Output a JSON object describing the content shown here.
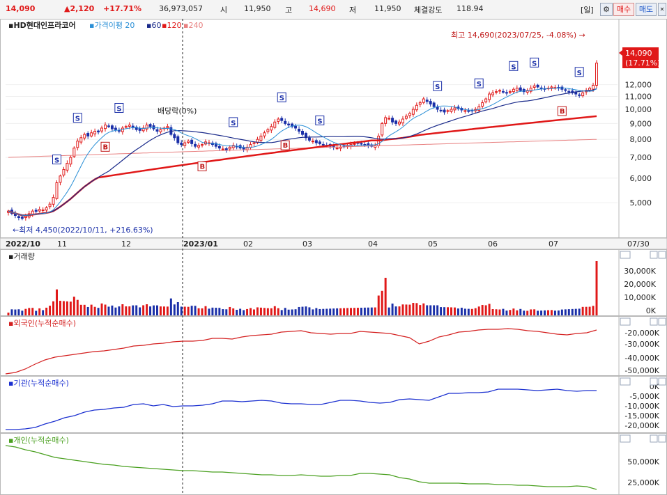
{
  "header": {
    "price": "14,090",
    "change": "▲2,120",
    "change_pct": "+17.71%",
    "volume": "36,973,057",
    "open_label": "시",
    "open": "11,950",
    "high_label": "고",
    "high": "14,690",
    "low_label": "저",
    "low": "11,950",
    "strength_label": "체결강도",
    "strength": "118.94",
    "period": "[일]",
    "sell_button": "매수",
    "buy_button": "매도"
  },
  "price_panel": {
    "name": "HD현대인프라코어",
    "legend_ma_label": "가격이평",
    "legend_ma": [
      "20",
      "60",
      "120",
      "240"
    ],
    "high_note": "최고 14,690(2023/07/25, -4.08%)",
    "low_note": "최저 4,450(2022/10/11, +216.63%)",
    "dividend_note": "배당락(0%)",
    "last_price": "14,090",
    "last_pct": "(17.71%)"
  },
  "volume_panel": {
    "title": "거래량"
  },
  "foreign_panel": {
    "title": "외국인(누적순매수)"
  },
  "inst_panel": {
    "title": "기관(누적순매수)"
  },
  "indiv_panel": {
    "title": "개인(누적순매수)"
  },
  "x_axis": {
    "labels": [
      "2022/10",
      "11",
      "12",
      "2023/01",
      "02",
      "03",
      "04",
      "05",
      "06",
      "07",
      "07/30"
    ]
  },
  "colors": {
    "up": "#e01818",
    "down": "#1a2fa8",
    "ma20": "#2a8fd6",
    "ma60": "#1a2a8a",
    "ma120": "#e01818",
    "ma240": "#e88080",
    "foreign": "#d42020",
    "inst": "#1a2fd0",
    "indiv": "#4aa020"
  },
  "chart_data": {
    "type": "candlestick",
    "log_scale": true,
    "y_ticks": [
      5000,
      6000,
      7000,
      8000,
      9000,
      10000,
      11000,
      12000
    ],
    "ylim": [
      4200,
      16500
    ],
    "closes": [
      4700,
      4620,
      4550,
      4480,
      4450,
      4520,
      4610,
      4700,
      4690,
      4760,
      4740,
      4820,
      4950,
      5200,
      5800,
      6100,
      6400,
      6700,
      7000,
      7500,
      7900,
      8100,
      8300,
      8200,
      8400,
      8500,
      8450,
      8700,
      8900,
      8800,
      8650,
      8600,
      8500,
      8700,
      8800,
      8900,
      8750,
      8600,
      8550,
      8700,
      8900,
      8800,
      8650,
      8500,
      8600,
      8700,
      8800,
      8300,
      8100,
      7800,
      7700,
      7800,
      7900,
      7750,
      7600,
      7650,
      7700,
      7850,
      7800,
      7700,
      7600,
      7500,
      7450,
      7400,
      7550,
      7650,
      7600,
      7500,
      7450,
      7550,
      7700,
      7800,
      8000,
      8200,
      8400,
      8600,
      8800,
      9100,
      9300,
      9200,
      9000,
      8900,
      8800,
      8700,
      8500,
      8300,
      8100,
      7950,
      7900,
      7800,
      7750,
      7700,
      7650,
      7600,
      7550,
      7500,
      7550,
      7600,
      7650,
      7700,
      7750,
      7800,
      7750,
      7700,
      7650,
      7600,
      7650,
      8200,
      9000,
      9400,
      9350,
      9100,
      9000,
      9100,
      9300,
      9500,
      9700,
      10000,
      10300,
      10500,
      10800,
      10600,
      10400,
      10200,
      10000,
      9900,
      9800,
      9900,
      10000,
      10100,
      10050,
      9950,
      9900,
      9850,
      9900,
      10000,
      10200,
      10500,
      10800,
      11200,
      11300,
      11400,
      11500,
      11350,
      11300,
      11400,
      11600,
      11700,
      11500,
      11400,
      11500,
      11700,
      11900,
      11800,
      11700,
      11600,
      11700,
      11800,
      11750,
      11700,
      11600,
      11500,
      11400,
      11300,
      11200,
      11100,
      11300,
      11500,
      11700,
      11950,
      14090
    ],
    "ma": {
      "20": "short moving average",
      "60": "medium moving average",
      "120": "long moving average",
      "240": "very long moving average"
    }
  }
}
